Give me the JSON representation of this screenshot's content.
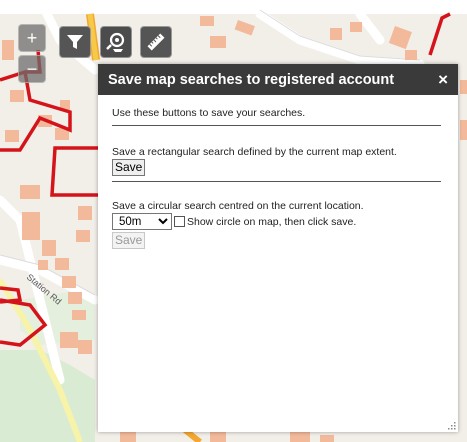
{
  "panel": {
    "title": "Save map searches to registered account",
    "close_label": "×",
    "intro": "Use these buttons to save your searches.",
    "rect_desc": "Save a rectangular search defined by the current map extent.",
    "rect_button": "Save",
    "circle_desc": "Save a circular search centred on the current location.",
    "radius_value": "50m",
    "radius_options": [
      "50m"
    ],
    "circle_check_label": "Show circle on map, then click save.",
    "circle_button": "Save"
  },
  "map": {
    "road_label": "Station Rd",
    "zoom_in": "+",
    "zoom_out": "−"
  },
  "colors": {
    "boundary": "#d4141a",
    "building": "#f2b99a",
    "major_road": "#f7c948",
    "minor_road": "#ffffff",
    "green": "#d9ecd3",
    "header": "#3a3a3a"
  },
  "icons": [
    "filter-icon",
    "search-location-icon",
    "ruler-icon",
    "close-icon"
  ]
}
